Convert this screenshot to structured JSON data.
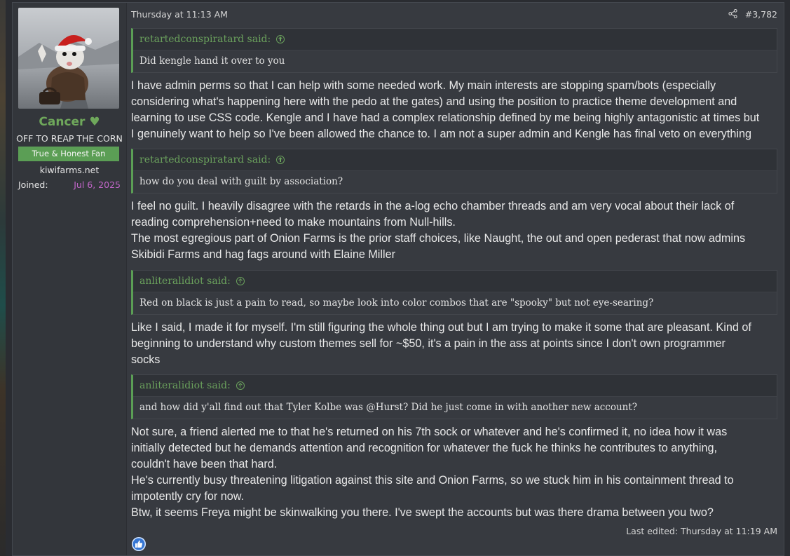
{
  "user": {
    "name": "Cancer ♥",
    "title": "OFF TO REAP THE CORN",
    "banner": "True & Honest Fan",
    "site": "kiwifarms.net",
    "joined_label": "Joined:",
    "joined_date": "Jul 6, 2025"
  },
  "post": {
    "date": "Thursday at 11:13 AM",
    "number": "#3,782",
    "share_icon": "share-icon",
    "reaction_icon": "thumbs-up-icon",
    "last_edited": "Last edited: Thursday at 11:19 AM",
    "quotes": [
      {
        "author": "retartedconspiratard said:",
        "text": "Did kengle hand it over to you"
      },
      {
        "author": "retartedconspiratard said:",
        "text": "how do you deal with guilt by association?"
      },
      {
        "author": "anliteralidiot said:",
        "text": "Red on black is just a pain to read, so maybe look into color combos that are \"spooky\" but not eye-searing?"
      },
      {
        "author": "anliteralidiot said:",
        "text": "and how did y'all find out that Tyler Kolbe was @Hurst? Did he just come in with another new account?"
      }
    ],
    "paragraphs": [
      [
        "I have admin perms so that I can help with some needed work. My main interests are stopping spam/bots (especially",
        "considering what's happening here with the pedo at the gates) and using the position to practice theme development and",
        "learning to use CSS code. Kengle and I have had a complex relationship defined by me being highly antagonistic at times but",
        "I genuinely want to help so I've been allowed the chance to. I am not a super admin and Kengle has final veto on everything"
      ],
      [
        "I feel no guilt. I heavily disagree with the retards in the a-log echo chamber threads and am very vocal about their lack of",
        "reading comprehension+need to make mountains from Null-hills.",
        "The most egregious part of Onion Farms is the prior staff choices, like Naught, the out and open pederast that now admins",
        "Skibidi Farms and hag fags around with Elaine Miller"
      ],
      [
        "Like I said, I made it for myself. I'm still figuring the whole thing out but I am trying to make it some that are pleasant. Kind of",
        "beginning to understand why custom themes sell for ~$50, it's a pain in the ass at points since I don't own programmer",
        "socks"
      ],
      [
        "Not sure, a friend alerted me to that he's returned on his 7th sock or whatever and he's confirmed it, no idea how it was",
        "initially detected but he demands attention and recognition for whatever the fuck he thinks he contributes to anything,",
        "couldn't have been that hard.",
        "He's currently busy threatening litigation against this site and Onion Farms, so we stuck him in his containment thread to",
        "impotently cry for now.",
        "Btw, it seems Freya might be skinwalking you there. I've swept the accounts but was there drama between you two?"
      ]
    ]
  },
  "colors": {
    "background": "#2a2c31",
    "post_bg": "#373a40",
    "quote_accent": "#5b9e55",
    "username": "#6fa85b",
    "joined_date": "#c266c9"
  }
}
